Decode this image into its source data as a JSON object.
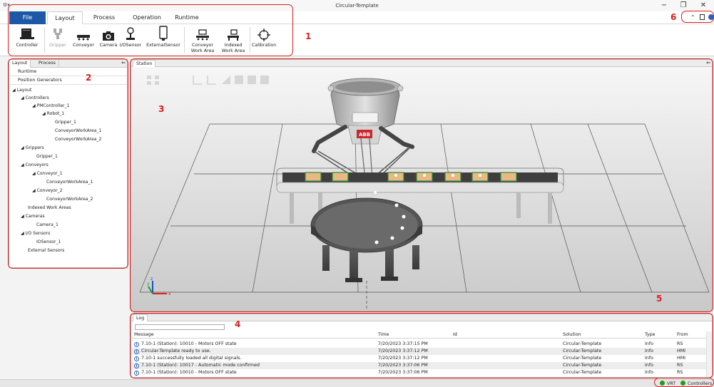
{
  "window": {
    "title": "Circular-Template",
    "app_icon": "app-quick-access-icon",
    "minimize_glyph": "−",
    "restore_glyph": "❐",
    "close_glyph": "✕"
  },
  "ribbon": {
    "tabs": [
      {
        "label": "File"
      },
      {
        "label": "Layout"
      },
      {
        "label": "Process"
      },
      {
        "label": "Operation"
      },
      {
        "label": "Runtime"
      }
    ],
    "buttons": [
      {
        "label": "Controller"
      },
      {
        "label": "Gripper"
      },
      {
        "label": "Conveyor"
      },
      {
        "label": "Camera"
      },
      {
        "label": "I/OSensor"
      },
      {
        "label": "ExternalSensor"
      },
      {
        "label_line1": "Conveyor",
        "label_line2": "Work Area"
      },
      {
        "label_line1": "Indexed",
        "label_line2": "Work Area"
      },
      {
        "label": "Calibration"
      }
    ]
  },
  "annotations": [
    "1",
    "2",
    "3",
    "4",
    "5",
    "6"
  ],
  "annotation_color": "#d81e1e",
  "left_panel": {
    "tabs": [
      {
        "label": "Layout"
      },
      {
        "label": "Process"
      }
    ],
    "pin": "⇐",
    "rows": [
      "Runtime",
      "Position Generators"
    ],
    "tree": [
      {
        "label": "Layout",
        "expand": "◢"
      },
      {
        "label": "Controllers",
        "expand": "◢"
      },
      {
        "label": "PMController_1",
        "expand": "◢"
      },
      {
        "label": "Robot_1",
        "expand": "◢"
      },
      {
        "label": "Gripper_1"
      },
      {
        "label": "ConveyorWorkArea_1"
      },
      {
        "label": "ConveyorWorkArea_2"
      },
      {
        "label": "Grippers",
        "expand": "◢"
      },
      {
        "label": "Gripper_1"
      },
      {
        "label": "Conveyors",
        "expand": "◢"
      },
      {
        "label": "Conveyor_1",
        "expand": "◢"
      },
      {
        "label": "ConveyorWorkArea_1"
      },
      {
        "label": "Conveyor_2",
        "expand": "◢"
      },
      {
        "label": "ConveyorWorkArea_2"
      },
      {
        "label": "Indexed Work Areas"
      },
      {
        "label": "Cameras",
        "expand": "◢"
      },
      {
        "label": "Camera_1"
      },
      {
        "label": "I/O Sensors",
        "expand": "◢"
      },
      {
        "label": "IOSensor_1"
      },
      {
        "label": "External Sensors"
      }
    ]
  },
  "station": {
    "tab": "Station",
    "pin": "⇐",
    "logo_text": "ABB",
    "axis_x": "x",
    "axis_y": "y",
    "axis_z": "z"
  },
  "log": {
    "tab": "Log",
    "filter_value": "",
    "columns": [
      "Message",
      "Time",
      "Id",
      "Solution",
      "Type",
      "From"
    ],
    "rows": [
      {
        "message": "7.10-1 (Station): 10010 - Motors OFF state",
        "time": "7/20/2023 3:37:15 PM",
        "id": "",
        "solution": "Circular-Template",
        "type": "Info",
        "from": "RS"
      },
      {
        "message": "Circular-Template ready to use.",
        "time": "7/20/2023 3:37:12 PM",
        "id": "",
        "solution": "Circular-Template",
        "type": "Info",
        "from": "HMI"
      },
      {
        "message": "7.10-1 successfully loaded all digital signals.",
        "time": "7/20/2023 3:37:12 PM",
        "id": "",
        "solution": "Circular-Template",
        "type": "Info",
        "from": "HMI"
      },
      {
        "message": "7.10-1 (Station): 10017 - Automatic mode confirmed",
        "time": "7/20/2023 3:37:06 PM",
        "id": "",
        "solution": "Circular-Template",
        "type": "Info",
        "from": "RS"
      },
      {
        "message": "7.10-1 (Station): 10010 - Motors OFF state",
        "time": "7/20/2023 3:37:06 PM",
        "id": "",
        "solution": "Circular-Template",
        "type": "Info",
        "from": "RS"
      }
    ]
  },
  "status_bar": {
    "items": [
      {
        "label": "VRT",
        "color": "#1f9d1f"
      },
      {
        "label": "Controllers",
        "color": "#1f9d1f"
      }
    ]
  },
  "colors": {
    "file_tab": "#1d58a6",
    "station_bg_top": "#f4f4f4",
    "station_bg_bottom": "#cfcfcf"
  }
}
